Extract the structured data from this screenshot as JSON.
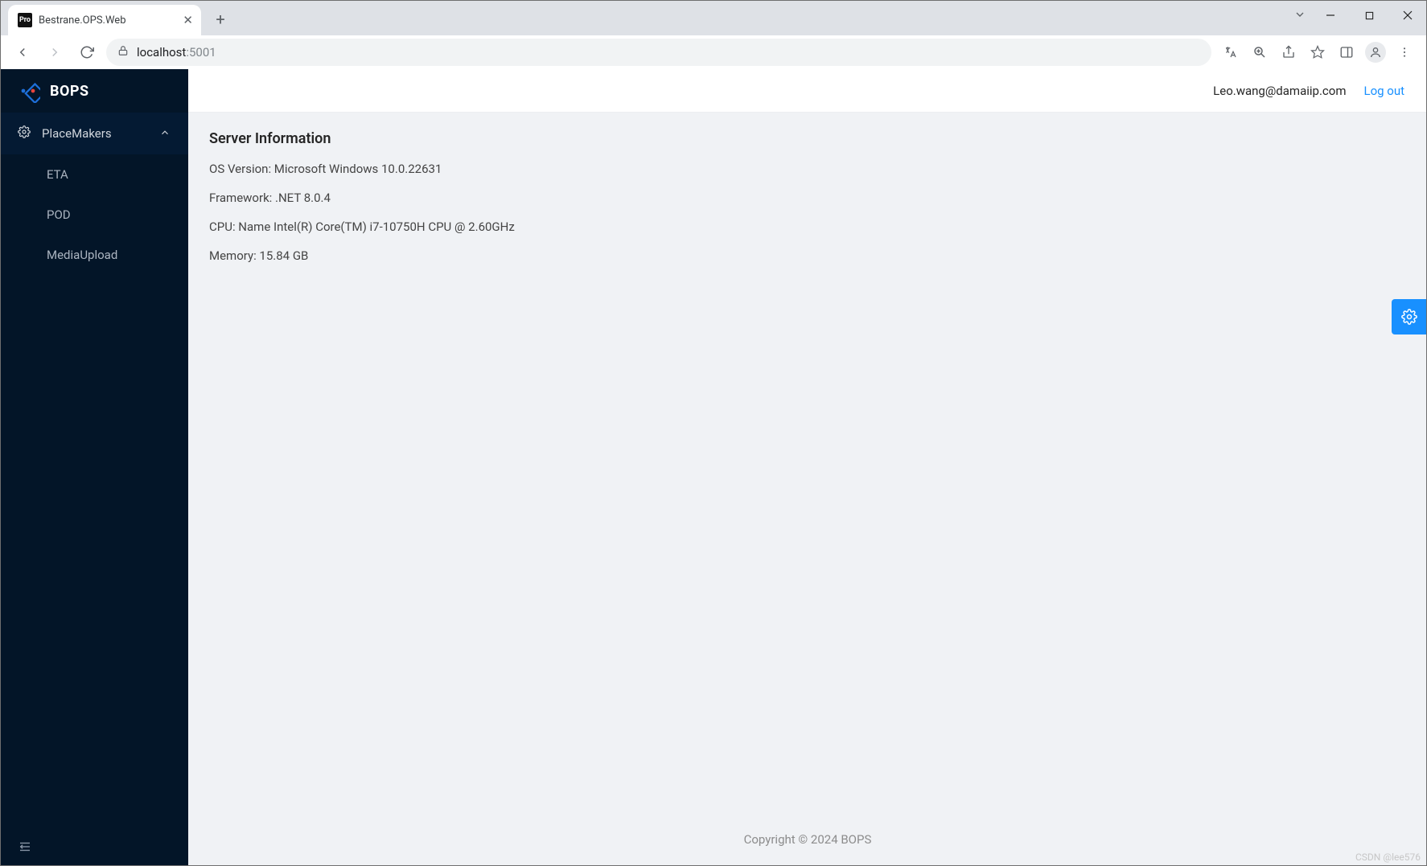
{
  "browser": {
    "tab_title": "Bestrane.OPS.Web",
    "favicon_text": "Pro",
    "url_host": "localhost",
    "url_port": ":5001"
  },
  "sidebar": {
    "logo_text": "BOPS",
    "group": {
      "label": "PlaceMakers"
    },
    "items": [
      {
        "label": "ETA"
      },
      {
        "label": "POD"
      },
      {
        "label": "MediaUpload"
      }
    ]
  },
  "topbar": {
    "user_email": "Leo.wang@damaiip.com",
    "logout": "Log out"
  },
  "content": {
    "heading": "Server Information",
    "os": "OS Version: Microsoft Windows 10.0.22631",
    "framework": "Framework: .NET 8.0.4",
    "cpu": "CPU: Name Intel(R) Core(TM) i7-10750H CPU @ 2.60GHz",
    "memory": "Memory: 15.84 GB"
  },
  "footer": {
    "copyright": "Copyright © 2024 BOPS"
  },
  "watermark": "CSDN @lee576"
}
